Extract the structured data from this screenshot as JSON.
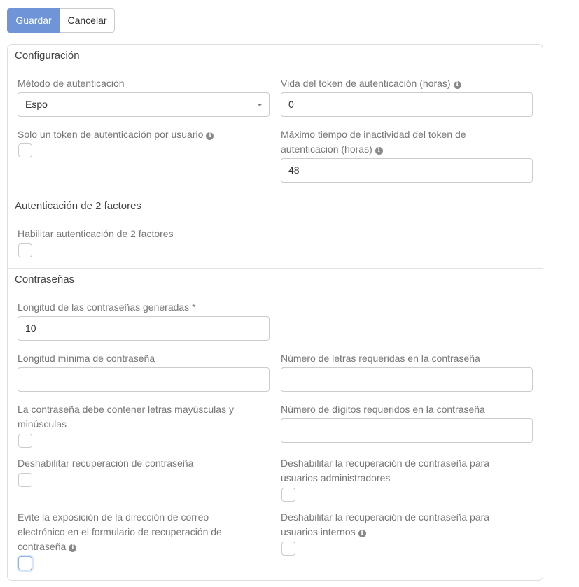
{
  "toolbar": {
    "save_label": "Guardar",
    "cancel_label": "Cancelar"
  },
  "sections": {
    "config": {
      "title": "Configuración",
      "auth_method_label": "Método de autenticación",
      "auth_method_value": "Espo",
      "token_lifetime_label": "Vida del token de autenticación (horas)",
      "token_lifetime_value": "0",
      "one_token_label": "Solo un token de autenticación por usuario",
      "max_idle_label_line1": "Máximo tiempo de inactividad del token de",
      "max_idle_label_line2": "autenticación (horas)",
      "max_idle_value": "48"
    },
    "twofa": {
      "title": "Autenticación de 2 factores",
      "enable_label": "Habilitar autenticación de 2 factores"
    },
    "passwords": {
      "title": "Contraseñas",
      "generated_length_label": "Longitud de las contraseñas generadas *",
      "generated_length_value": "10",
      "min_length_label": "Longitud mínima de contraseña",
      "min_length_value": "",
      "letters_required_label": "Número de letras requeridas en la contraseña",
      "letters_required_value": "",
      "upper_lower_label_line1": "La contraseña debe contener letras mayúsculas y",
      "upper_lower_label_line2": "minúsculas",
      "digits_required_label": "Número de dígitos requeridos en la contraseña",
      "digits_required_value": "",
      "disable_recovery_label": "Deshabilitar recuperación de contraseña",
      "disable_recovery_admin_line1": "Deshabilitar la recuperación de contraseña para",
      "disable_recovery_admin_line2": "usuarios administradores",
      "avoid_exposure_line1": "Evite la exposición de la dirección de correo",
      "avoid_exposure_line2": "electrónico en el formulario de recuperación de",
      "avoid_exposure_line3": "contraseña",
      "disable_recovery_internal_line1": "Deshabilitar la recuperación de contraseña para",
      "disable_recovery_internal_line2": "usuarios internos"
    }
  },
  "icons": {
    "info": "info-icon",
    "caret": "chevron-down-icon"
  },
  "colors": {
    "primary": "#6f95d8",
    "border": "#cccccc",
    "label": "#777777"
  }
}
